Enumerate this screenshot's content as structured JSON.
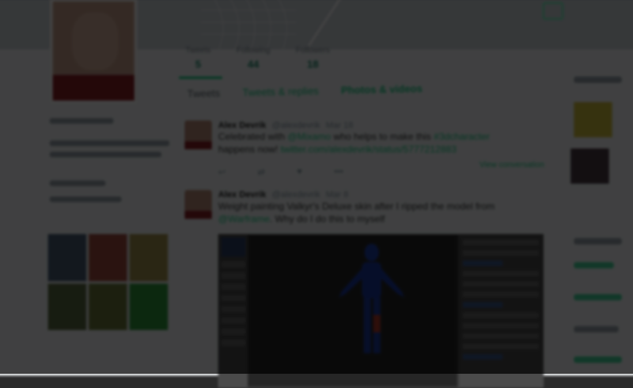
{
  "profile": {
    "stats": [
      {
        "label": "Tweets",
        "value": "5"
      },
      {
        "label": "Following",
        "value": "44"
      },
      {
        "label": "Followers",
        "value": "18"
      }
    ],
    "active_stat_label": "Tweets"
  },
  "tabs": [
    {
      "label": "Tweets",
      "active": false
    },
    {
      "label": "Tweets & replies",
      "active": false
    },
    {
      "label": "Photos & videos",
      "active": true
    }
  ],
  "tweets": [
    {
      "name": "Alex Devrik",
      "handle": "@alexdevrik",
      "date": "Mar 18",
      "text_pre": "Celebrated with ",
      "mention": "@Mixamo",
      "text_mid": " who helps to make this ",
      "hashtag": "#3dcharacter",
      "text_post": " happens now! ",
      "link": "twitter.com/alexdevrik/status/5777212883",
      "view_conversation": "View conversation"
    },
    {
      "name": "Alex Devrik",
      "handle": "@alexdevrik",
      "date": "Mar 8",
      "text_pre": "Weight painting Valkyr's Deluxe skin after I ripped the model from ",
      "mention": "@Warframe",
      "text_post": ". Why do I do this to myself"
    }
  ],
  "colors": {
    "accent": "#19cf86",
    "overlay": "rgba(0,0,0,0.74)"
  }
}
